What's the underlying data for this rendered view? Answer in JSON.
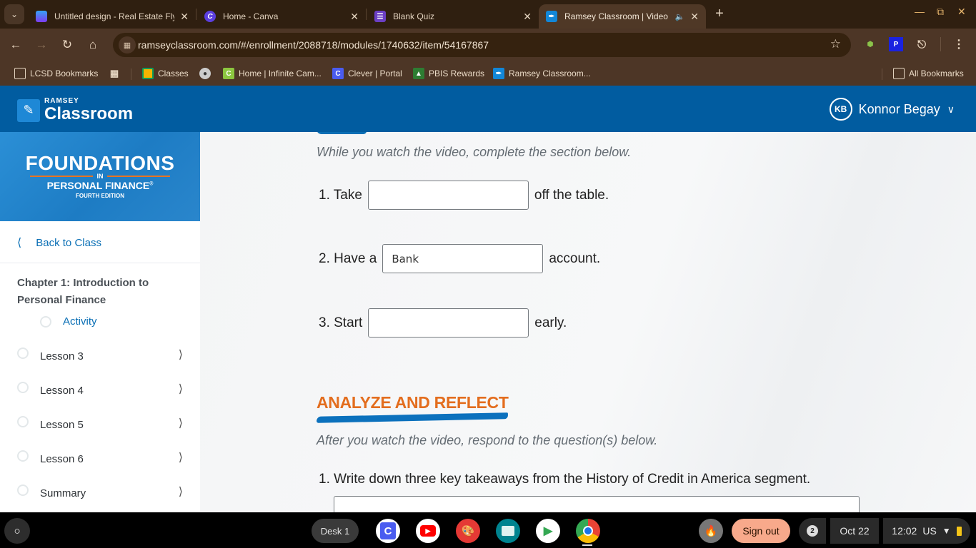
{
  "browser": {
    "tabs": [
      {
        "title": "Untitled design - Real Estate Fly",
        "favicon": "canva-print-icon",
        "active": false
      },
      {
        "title": "Home - Canva",
        "favicon": "canva-icon",
        "active": false
      },
      {
        "title": "Blank Quiz",
        "favicon": "google-forms-icon",
        "active": false
      },
      {
        "title": "Ramsey Classroom | Video",
        "favicon": "ramsey-icon",
        "active": true,
        "audio": true
      }
    ],
    "url": "ramseyclassroom.com/#/enrollment/2088718/modules/1740632/item/54167867",
    "bookmarks": [
      {
        "label": "LCSD Bookmarks",
        "icon": "folder-managed-icon"
      },
      {
        "label": "",
        "icon": "apps-grid-icon"
      },
      {
        "label": "Classes",
        "icon": "google-classroom-icon"
      },
      {
        "label": "",
        "icon": "globe-icon"
      },
      {
        "label": "Home | Infinite Cam...",
        "icon": "infinite-campus-icon"
      },
      {
        "label": "Clever | Portal",
        "icon": "clever-icon"
      },
      {
        "label": "PBIS Rewards",
        "icon": "pbis-icon"
      },
      {
        "label": "Ramsey Classroom...",
        "icon": "ramsey-icon"
      }
    ],
    "all_bookmarks": "All Bookmarks"
  },
  "header": {
    "logo_small": "RAMSEY",
    "logo_big": "Classroom",
    "user_initials": "KB",
    "user_name": "Konnor Begay"
  },
  "sidebar": {
    "banner": {
      "title": "FOUNDATIONS",
      "in": "IN",
      "subtitle": "PERSONAL FINANCE",
      "registered": "®",
      "edition": "FOURTH EDITION"
    },
    "back_label": "Back to Class",
    "chapter_title": "Chapter 1: Introduction to Personal Finance",
    "activity_label": "Activity",
    "lessons": [
      {
        "label": "Lesson 3"
      },
      {
        "label": "Lesson 4"
      },
      {
        "label": "Lesson 5"
      },
      {
        "label": "Lesson 6"
      },
      {
        "label": "Summary"
      }
    ]
  },
  "main": {
    "watch_instruction": "While you watch the video, complete the section below.",
    "fill_ins": [
      {
        "prefix": "1. Take",
        "value": "",
        "suffix": "off the table."
      },
      {
        "prefix": "2. Have a",
        "value": "Bank",
        "suffix": "account."
      },
      {
        "prefix": "3. Start",
        "value": "",
        "suffix": "early."
      }
    ],
    "section_heading": "ANALYZE AND REFLECT",
    "after_instruction": "After you watch the video, respond to the question(s) below.",
    "question_1": "1. Write down three key takeaways from the History of Credit in America segment.",
    "answer_1": ""
  },
  "shelf": {
    "desk_label": "Desk 1",
    "apps": [
      "clever-icon",
      "youtube-icon",
      "canvas-paint-icon",
      "classroom-news-icon",
      "play-store-icon",
      "chrome-icon"
    ],
    "sign_out": "Sign out",
    "notification_count": "2",
    "date": "Oct 22",
    "time": "12:02",
    "locale": "US"
  },
  "colors": {
    "brand_blue": "#015ca0",
    "link_blue": "#0a6fb5",
    "accent_orange": "#e36d1e",
    "chrome_dark": "#2f1f10",
    "chrome_toolbar": "#4d3626"
  }
}
